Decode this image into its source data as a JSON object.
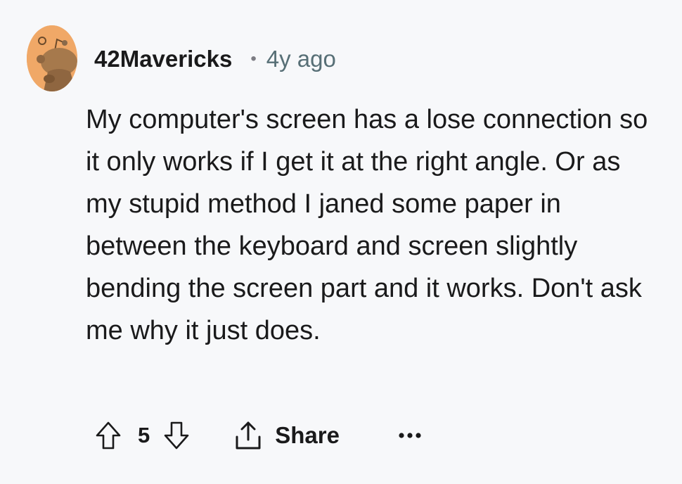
{
  "comment": {
    "avatar_icon": "reddit-snoo-avatar-icon",
    "username": "42Mavericks",
    "separator": "•",
    "timestamp": "4y ago",
    "body": "My computer's screen has a lose connection so it only works if I get it at the right angle. Or as my stupid method I janed some paper in between the keyboard and screen slightly bending the screen part and it works. Don't ask me why it just does.",
    "actions": {
      "upvote_icon": "upvote-arrow-icon",
      "score": "5",
      "downvote_icon": "downvote-arrow-icon",
      "share_icon": "share-icon",
      "share_label": "Share",
      "more_icon": "more-options-icon"
    }
  },
  "colors": {
    "background": "#f7f8fa",
    "avatar_bg": "#f0a867",
    "text": "#1a1a1b",
    "muted": "#576f76"
  }
}
